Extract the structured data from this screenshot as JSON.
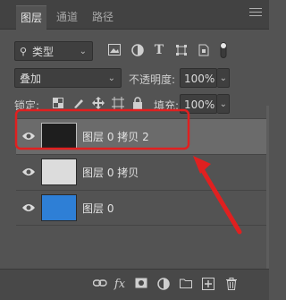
{
  "tabs": [
    {
      "label": "图层"
    },
    {
      "label": "通道"
    },
    {
      "label": "路径"
    }
  ],
  "filter": {
    "kind_label": "类型"
  },
  "blend": {
    "mode": "叠加",
    "opacity_label": "不透明度:",
    "opacity_value": "100%"
  },
  "lock": {
    "label": "锁定:",
    "fill_label": "填充:",
    "fill_value": "100%"
  },
  "layers": [
    {
      "name": "图层 0 拷贝 2",
      "selected": true,
      "thumb_color": "#1e1e1e"
    },
    {
      "name": "图层 0 拷贝",
      "selected": false,
      "thumb_color": "#dcdcdc"
    },
    {
      "name": "图层 0",
      "selected": false,
      "thumb_color": "#2e7fd6"
    }
  ],
  "annotation": {
    "highlight_color": "#e02020",
    "arrow_color": "#e02020"
  },
  "footer": {
    "fx_label": "fx"
  }
}
